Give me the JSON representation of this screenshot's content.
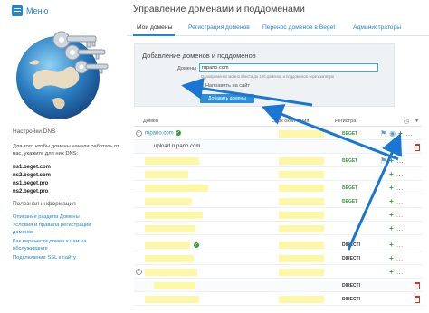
{
  "sidebar": {
    "menu_label": "Меню",
    "dns_title": "Настройки DNS",
    "dns_text": "Для того чтобы домены начали работать от нас, укажите для них DNS:",
    "ns": [
      "ns1.beget.com",
      "ns2.beget.com",
      "ns1.beget.pro",
      "ns2.beget.pro"
    ],
    "info_title": "Полезная информация",
    "links": [
      "Описание раздела Домены",
      "Условия и правила регистрации доменов",
      "Как перенести домен к нам на обслуживание",
      "Подключение SSL к сайту"
    ]
  },
  "header": {
    "title": "Управление доменами и поддоменами"
  },
  "tabs": [
    {
      "label": "Мои домены",
      "active": true
    },
    {
      "label": "Регистрация доменов",
      "active": false
    },
    {
      "label": "Перенос доменов в Beget",
      "active": false
    },
    {
      "label": "Администраторы",
      "active": false
    }
  ],
  "add_form": {
    "title": "Добавление доменов и поддоменов",
    "domains_label": "Домены",
    "domain_value": "rupano.com",
    "hint": "Одновременно можно ввести до 100 доменов и поддоменов через запятую",
    "redirect_label": "Направить на сайт",
    "submit_label": "Добавить домены"
  },
  "table": {
    "headers": [
      "Домен",
      "Срок окончания",
      "Регистра"
    ],
    "rows": [
      {
        "domain": "rupano.com",
        "registrar": "BEGET",
        "registrar_color": "#3a9c3a"
      },
      {
        "domain": "upload.rupano.com",
        "registrar": ""
      },
      {
        "domain": "",
        "registrar": "BEGET",
        "registrar_color": "#3a9c3a"
      },
      {
        "domain": "",
        "registrar": ""
      },
      {
        "domain": "",
        "registrar": "BEGET",
        "registrar_color": "#3a9c3a"
      },
      {
        "domain": "",
        "registrar": "BEGET",
        "registrar_color": "#3a9c3a"
      },
      {
        "domain": "",
        "registrar": "DIRECTI",
        "registrar_color": "#333333"
      },
      {
        "domain": "",
        "registrar": "DIRECTI",
        "registrar_color": "#333333"
      },
      {
        "domain": "",
        "registrar": ""
      },
      {
        "domain": "",
        "registrar": "DIRECTI",
        "registrar_color": "#333333"
      },
      {
        "domain": "",
        "registrar": "DIRECTI",
        "registrar_color": "#333333"
      }
    ]
  },
  "colors": {
    "accent": "#1e88d6",
    "highlight": "#fdf7a8",
    "arrow": "#1976d2",
    "ok": "#3a9c3a"
  },
  "icons": [
    "menu-icon",
    "globe-keys-image",
    "clock-icon",
    "filter-icon",
    "plus-icon",
    "dots-icon",
    "flag-icon",
    "trash-icon",
    "expand-icon",
    "check-icon"
  ]
}
